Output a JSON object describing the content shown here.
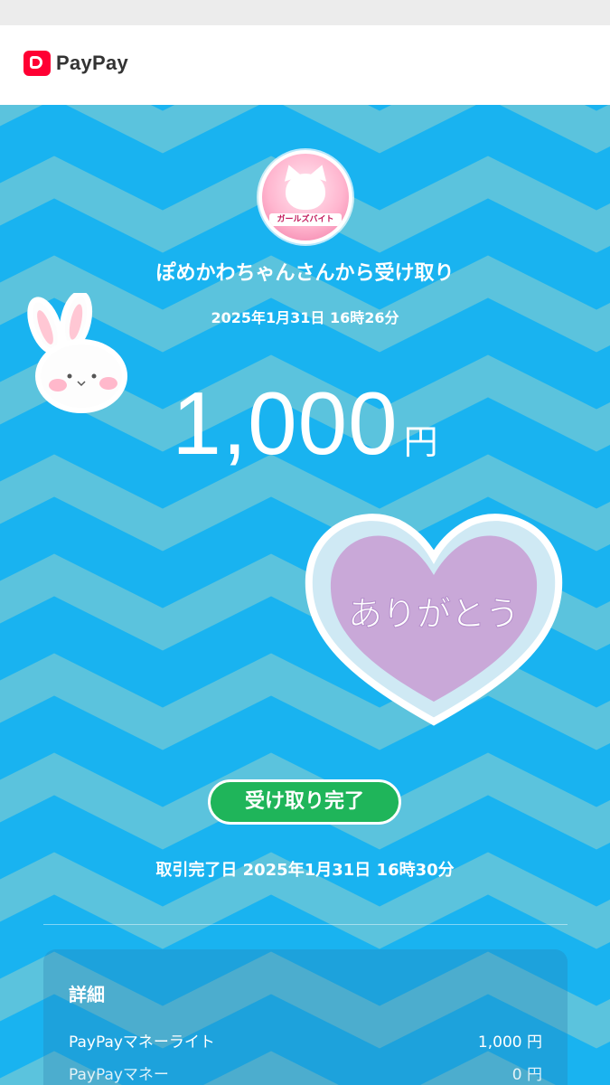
{
  "app": {
    "name": "PayPay",
    "brand_color": "#ff0033",
    "background_color": "#19b3f0"
  },
  "header": {
    "logo_text": "PayPay"
  },
  "receipt": {
    "sender_line": "ぽめかわちゃんさんから受け取り",
    "received_at": "2025年1月31日 16時26分",
    "amount": "1,000",
    "currency": "円",
    "sticker_text": "ありがとう",
    "status_badge": "受け取り完了",
    "completed_label": "取引完了日",
    "completed_at": "2025年1月31日 16時30分",
    "avatar_label": "ガールズバイト"
  },
  "details": {
    "title": "詳細",
    "rows": [
      {
        "label": "PayPayマネーライト",
        "value": "1,000 円"
      },
      {
        "label": "PayPayマネー",
        "value": "0 円"
      }
    ]
  },
  "icons": {
    "logo": "paypay-logo-icon",
    "sticker_bunny": "bunny-sticker-icon",
    "sticker_heart": "heart-sticker-icon"
  }
}
